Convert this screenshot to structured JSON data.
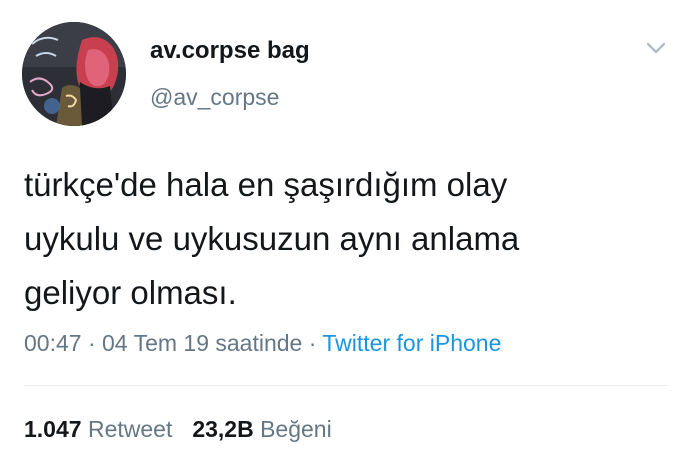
{
  "user": {
    "display_name": "av.corpse bag",
    "handle": "@av_corpse",
    "avatar_icon": "profile-avatar"
  },
  "tweet": {
    "lines": [
      "türkçe'de hala en şaşırdığım olay",
      "uykulu ve uykusuzun aynı anlama",
      "geliyor olması."
    ]
  },
  "meta": {
    "time": "00:47",
    "sep1": " · ",
    "date": "04 Tem 19 saatinde",
    "sep2": " · ",
    "source": "Twitter for iPhone"
  },
  "stats": {
    "retweets_count": "1.047",
    "retweets_label": "Retweet",
    "likes_count": "23,2B",
    "likes_label": "Beğeni"
  },
  "colors": {
    "text": "#14171a",
    "secondary": "#657786",
    "link": "#1b95e0",
    "divider": "#e6ecf0"
  },
  "icons": {
    "more": "chevron-down-icon"
  }
}
